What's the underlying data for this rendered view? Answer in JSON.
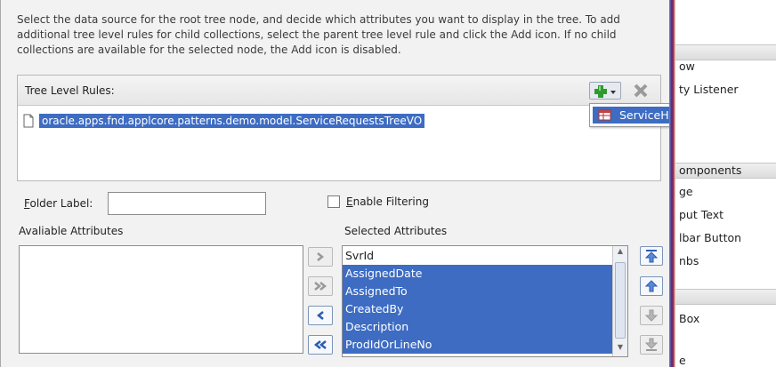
{
  "intro_text": "Select the data source for the root tree node, and decide which attributes you want to display in the tree. To add additional tree level rules for child collections, select the parent tree level rule and click the Add icon. If no child collections are available for the selected node, the Add icon is disabled.",
  "rules": {
    "label": "Tree Level Rules:",
    "root_node": "oracle.apps.fnd.applcore.patterns.demo.model.ServiceRequestsTreeVO",
    "add_menu_item": "ServiceHistoriesTree"
  },
  "folder": {
    "label_first": "F",
    "label_rest": "older Label:",
    "value": ""
  },
  "filtering": {
    "label_first": "E",
    "label_rest": "nable Filtering",
    "checked": false
  },
  "available": {
    "label": "Avaliable Attributes",
    "items": []
  },
  "selected": {
    "label": "Selected Attributes",
    "items": [
      "SvrId",
      "AssignedDate",
      "AssignedTo",
      "CreatedBy",
      "Description",
      "ProdIdOrLineNo"
    ]
  },
  "right_panel": {
    "items": [
      "ow",
      "ty Listener",
      "omponents",
      "ge",
      "put Text",
      "lbar Button",
      "nbs",
      "Box",
      "e"
    ]
  },
  "colors": {
    "selection": "#3d6cc2",
    "add_green": "#2e9a2e"
  }
}
